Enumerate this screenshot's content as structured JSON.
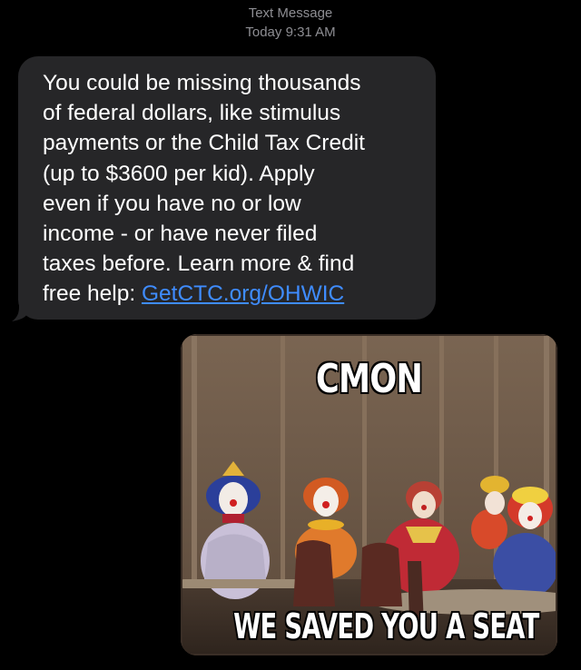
{
  "header": {
    "service": "Text Message",
    "timestamp": "Today 9:31 AM"
  },
  "message": {
    "lines": [
      "You could be missing thousands",
      "of federal dollars, like stimulus",
      "payments or the Child Tax Credit",
      "(up to $3600 per kid). Apply",
      "even if you have no or low",
      "income - or have never filed",
      "taxes before. Learn more & find"
    ],
    "last_line_prefix": "free help: ",
    "link_text": "GetCTC.org/OHWIC"
  },
  "meme": {
    "top_caption": "CMON",
    "bottom_caption": "WE SAVED YOU A SEAT"
  },
  "colors": {
    "background": "#000000",
    "bubble": "#262628",
    "link": "#3f8cff",
    "header_text": "#8e8e93"
  }
}
